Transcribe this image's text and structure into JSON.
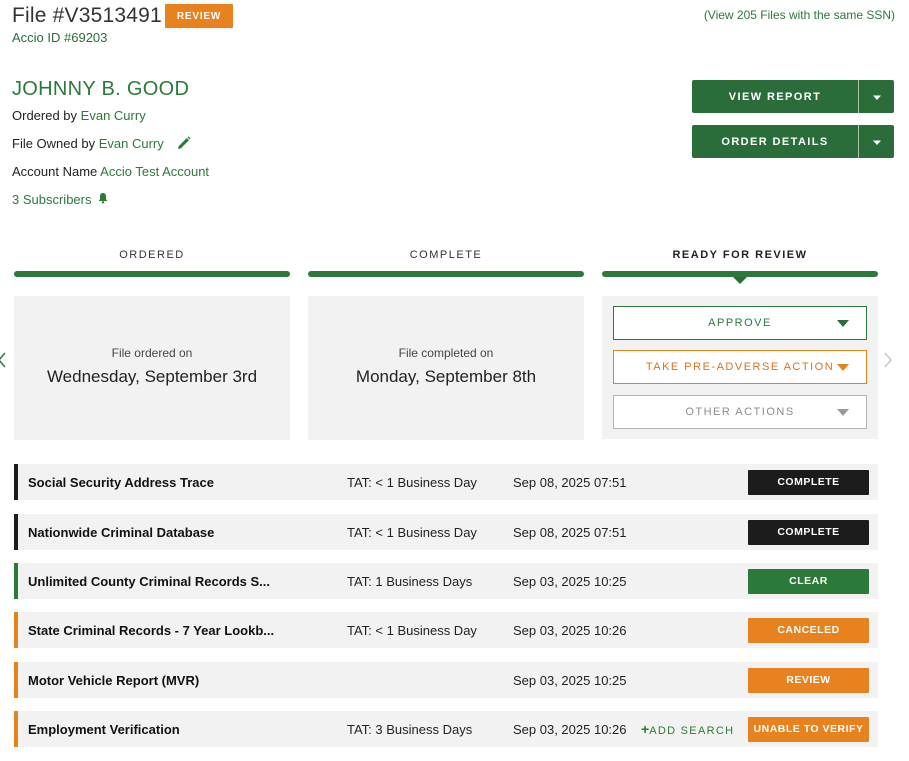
{
  "header": {
    "file_title": "File #V3513491",
    "badge": "REVIEW",
    "accio_id": "Accio ID #69203",
    "same_ssn_link": "(View 205 Files with the same SSN)"
  },
  "subject": {
    "name": "JOHNNY B. GOOD",
    "ordered_by_label": "Ordered by",
    "ordered_by": "Evan Curry",
    "owned_by_label": "File Owned by",
    "owned_by": "Evan Curry",
    "account_label": "Account Name",
    "account": "Accio Test Account",
    "subscribers": "3 Subscribers"
  },
  "actions": {
    "view_report": "VIEW REPORT",
    "order_details": "ORDER DETAILS"
  },
  "progress": {
    "steps": [
      {
        "label": "ORDERED",
        "sub": "File ordered on",
        "date": "Wednesday, September 3rd"
      },
      {
        "label": "COMPLETE",
        "sub": "File completed on",
        "date": "Monday, September 8th"
      },
      {
        "label": "READY FOR REVIEW"
      }
    ],
    "active_step": 3,
    "review_actions": [
      "APPROVE",
      "TAKE PRE-ADVERSE ACTION",
      "OTHER ACTIONS"
    ]
  },
  "searches": [
    {
      "name": "Social Security Address Trace",
      "tat": "TAT: < 1 Business Day",
      "date": "Sep 08, 2025 07:51",
      "status": "COMPLETE",
      "color": "#1c1c1c"
    },
    {
      "name": "Nationwide Criminal Database",
      "tat": "TAT: < 1 Business Day",
      "date": "Sep 08, 2025 07:51",
      "status": "COMPLETE",
      "color": "#1c1c1c"
    },
    {
      "name": "Unlimited County Criminal Records S...",
      "tat": "TAT: 1 Business Days",
      "date": "Sep 03, 2025 10:25",
      "status": "CLEAR",
      "color": "#2b7a3b"
    },
    {
      "name": "State Criminal Records - 7 Year Lookb...",
      "tat": "TAT: < 1 Business Day",
      "date": "Sep 03, 2025 10:26",
      "status": "CANCELED",
      "color": "#e8821e"
    },
    {
      "name": "Motor Vehicle Report (MVR)",
      "tat": "",
      "date": "Sep 03, 2025 10:25",
      "status": "REVIEW",
      "color": "#e8821e"
    },
    {
      "name": "Employment Verification",
      "tat": "TAT: 3 Business Days",
      "date": "Sep 03, 2025 10:26",
      "status": "UNABLE TO VERIFY",
      "color": "#e8821e",
      "extra_action": "ADD SEARCH"
    }
  ],
  "icons": {
    "edit": "pencil-icon",
    "subscribers": "bell-icon",
    "add": "plus-icon",
    "nav_prev": "chevron-left-icon",
    "nav_next": "chevron-right-icon"
  },
  "colors": {
    "brand_green": "#2b7a3b",
    "dark_green": "#2b6d3a",
    "orange": "#e8821e",
    "black": "#1c1c1c",
    "panel_gray": "#f2f2f2"
  }
}
